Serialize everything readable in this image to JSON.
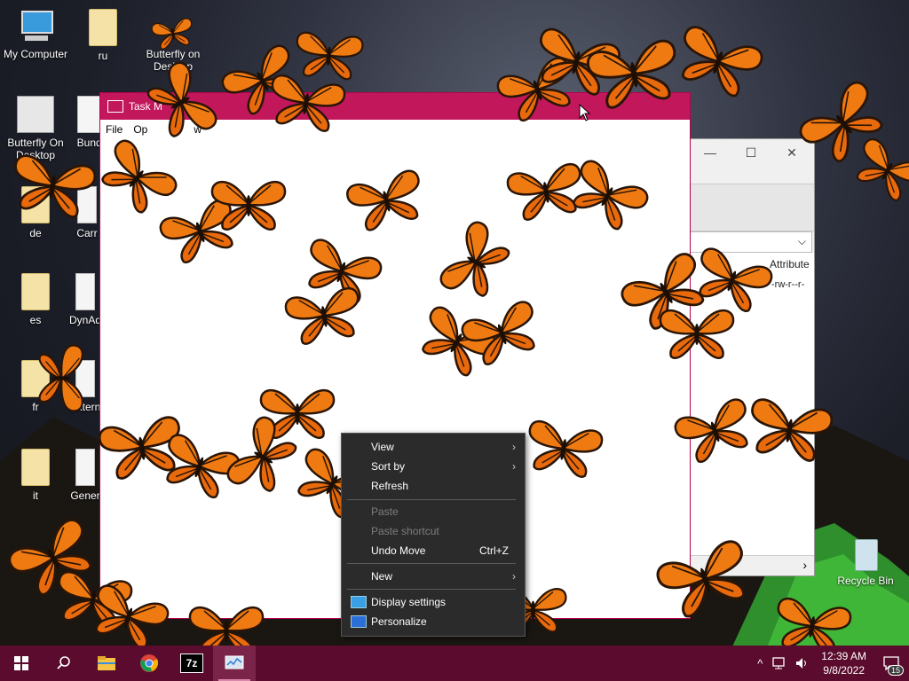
{
  "desktop": {
    "icons": [
      {
        "label": "My Computer"
      },
      {
        "label": "ru"
      },
      {
        "label": "Butterfly on Desktop"
      },
      {
        "label": "Butterfly On Desktop"
      },
      {
        "label": "Bundl"
      },
      {
        "label": "de"
      },
      {
        "label": "Carr"
      },
      {
        "label": "es"
      },
      {
        "label": "DynAd"
      },
      {
        "label": "fr"
      },
      {
        "label": "Extern"
      },
      {
        "label": "it"
      },
      {
        "label": "Gener"
      },
      {
        "label": "Recycle Bin"
      }
    ]
  },
  "task_manager": {
    "title": "Task M",
    "menu": [
      "File",
      "Op",
      "w"
    ]
  },
  "bg_window": {
    "minimize": "—",
    "maximize": "☐",
    "close": "✕",
    "column_header": "Attribute",
    "cell": "-rw-r--r-",
    "scroll_right": "›",
    "combo_arrow": "⌵"
  },
  "context_menu": {
    "items": [
      {
        "label": "View",
        "submenu": true
      },
      {
        "label": "Sort by",
        "submenu": true
      },
      {
        "label": "Refresh"
      },
      {
        "label": "Paste",
        "disabled": true
      },
      {
        "label": "Paste shortcut",
        "disabled": true
      },
      {
        "label": "Undo Move",
        "shortcut": "Ctrl+Z"
      },
      {
        "label": "New",
        "submenu": true
      },
      {
        "label": "Display settings",
        "icon": "display-icon"
      },
      {
        "label": "Personalize",
        "icon": "personalize-icon"
      }
    ],
    "arrow": "›"
  },
  "taskbar": {
    "apps": [
      "start-icon",
      "search-icon",
      "file-explorer-icon",
      "chrome-icon",
      "7zip-icon",
      "task-manager-icon"
    ],
    "seven_zip_label": "7z",
    "tray_up_arrow": "^",
    "time": "12:39 AM",
    "date": "9/8/2022",
    "notification_count": "15"
  },
  "colors": {
    "accent": "#c2185b",
    "taskbar": "#5b0b2d",
    "butterfly_orange": "#f07a12"
  }
}
